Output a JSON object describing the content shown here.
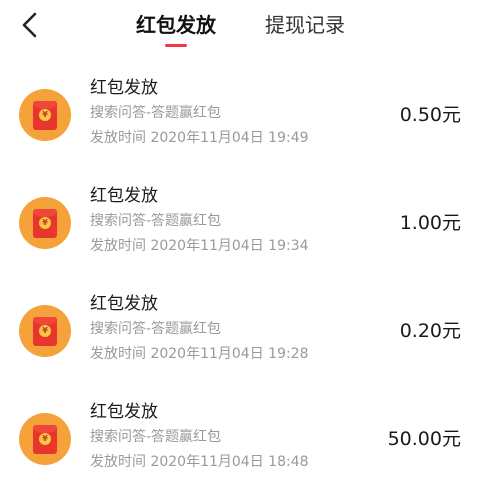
{
  "header": {
    "back_icon": "chevron-left-icon",
    "tabs": [
      {
        "label": "红包发放",
        "active": true
      },
      {
        "label": "提现记录",
        "active": false
      }
    ],
    "accent_color": "#f2364c"
  },
  "records": [
    {
      "title": "红包发放",
      "source": "搜索问答-答题赢红包",
      "time": "发放时间 2020年11月04日 19:49",
      "amount": "0.50元",
      "icon": "red-envelope-icon"
    },
    {
      "title": "红包发放",
      "source": "搜索问答-答题赢红包",
      "time": "发放时间 2020年11月04日 19:34",
      "amount": "1.00元",
      "icon": "red-envelope-icon"
    },
    {
      "title": "红包发放",
      "source": "搜索问答-答题赢红包",
      "time": "发放时间 2020年11月04日 19:28",
      "amount": "0.20元",
      "icon": "red-envelope-icon"
    },
    {
      "title": "红包发放",
      "source": "搜索问答-答题赢红包",
      "time": "发放时间 2020年11月04日 18:48",
      "amount": "50.00元",
      "icon": "red-envelope-icon"
    }
  ],
  "colors": {
    "avatar_bg": "#f6a23a",
    "envelope": "#e8362e",
    "coin": "#f7c843",
    "secondary_text": "#9a9a9a"
  }
}
